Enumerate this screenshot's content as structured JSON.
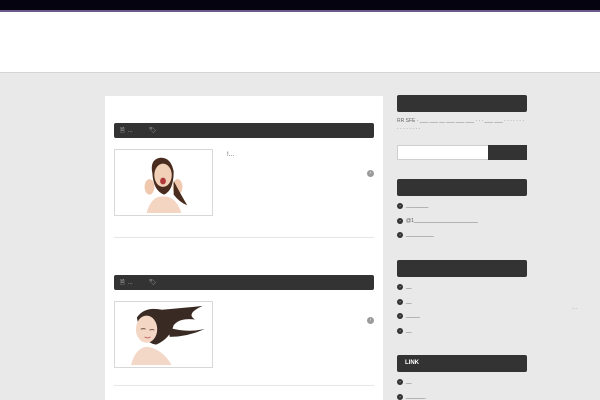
{
  "posts": [
    {
      "meta_date": "…",
      "meta_tag": "",
      "excerpt": "!…",
      "more_icon": "chevron-right-icon"
    },
    {
      "meta_date": "…",
      "meta_tag": "",
      "excerpt": "",
      "more_icon": "chevron-right-icon"
    }
  ],
  "sidebar": {
    "widget1": {
      "title": "",
      "rss_text": "RR SFE · ___ ___ __ ___ ___ ___ · · · ___ ___ · · · · · · · · · · · · · · ·"
    },
    "search": {
      "placeholder": "",
      "button_label": ""
    },
    "widget2": {
      "title": "",
      "items": [
        "________",
        "@1_______________________",
        "__________"
      ]
    },
    "widget3": {
      "title": "",
      "items": [
        "__",
        "__",
        "_____",
        "__"
      ]
    },
    "widget4": {
      "title": "LINK",
      "items": [
        "__",
        "_______"
      ]
    }
  },
  "right_edge_text": "···",
  "colors": {
    "topbar": "#05030f",
    "accent_line": "#6a5b8c",
    "dark_bar": "#333333",
    "page_bg": "#e9e9e9"
  }
}
